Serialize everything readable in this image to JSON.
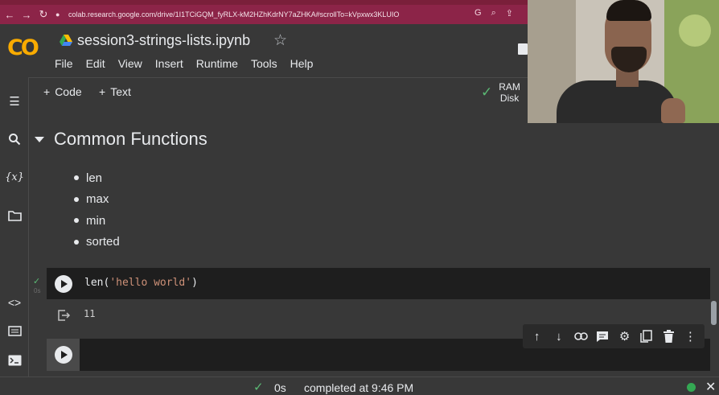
{
  "browser": {
    "url": "colab.research.google.com/drive/1I1TCiGQM_fyRLX-kM2HZhKdrNY7aZHKA#scrollTo=kVpxwx3KLUIO"
  },
  "header": {
    "logo": "CO",
    "notebook_title": "session3-strings-lists.ipynb",
    "menu": [
      "File",
      "Edit",
      "View",
      "Insert",
      "Runtime",
      "Tools",
      "Help"
    ]
  },
  "toolbar": {
    "code_label": "Code",
    "text_label": "Text",
    "ram_label": "RAM",
    "disk_label": "Disk"
  },
  "notebook": {
    "section_title": "Common Functions",
    "bullets": [
      "len",
      "max",
      "min",
      "sorted"
    ],
    "cell1": {
      "code_fn": "len(",
      "code_str": "'hello world'",
      "code_end": ")",
      "exec_time": "0s",
      "output": "11"
    }
  },
  "statusbar": {
    "elapsed": "0s",
    "completed": "completed at 9:46 PM"
  },
  "colors": {
    "accent_green": "#5bb974",
    "logo_orange": "#f9ab00",
    "string_literal": "#ce9178",
    "browser_chrome": "#8c2448"
  },
  "icons": {
    "sidebar": [
      "table-of-contents-icon",
      "search-icon",
      "variables-icon",
      "files-icon",
      "code-snippets-icon",
      "command-palette-icon",
      "terminal-icon"
    ],
    "cell_toolbar": [
      "move-up-icon",
      "move-down-icon",
      "link-icon",
      "comment-icon",
      "settings-icon",
      "mirror-cell-icon",
      "delete-icon",
      "more-icon"
    ]
  }
}
